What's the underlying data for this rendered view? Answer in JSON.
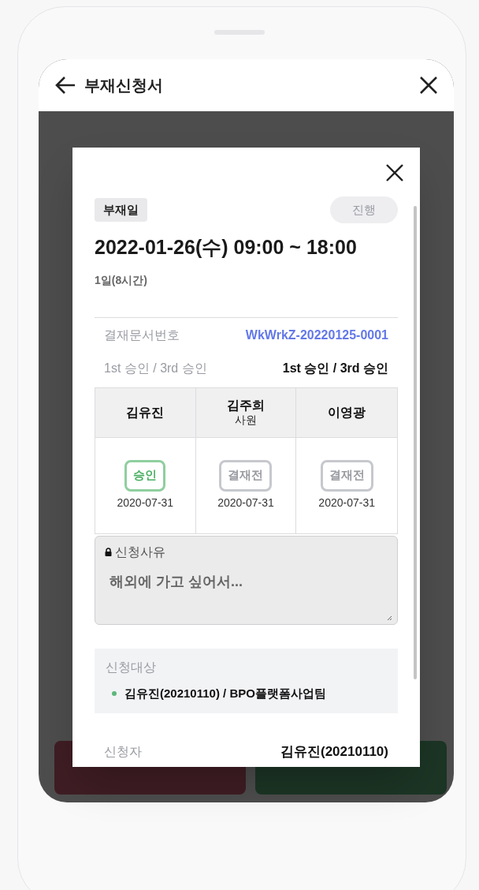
{
  "header": {
    "title": "부재신청서"
  },
  "modal": {
    "type_badge": "부재일",
    "status_badge": "진행",
    "datetime": "2022-01-26(수) 09:00 ~ 18:00",
    "duration": "1일(8시간)",
    "doc_number": {
      "label": "결재문서번호",
      "value": "WkWrkZ-20220125-0001"
    },
    "approval_line": {
      "label": "1st 승인 / 3rd 승인",
      "value": "1st 승인 / 3rd 승인"
    },
    "approvers": [
      {
        "name": "김유진",
        "kind": "approved",
        "status": "승인",
        "date": "2020-07-31"
      },
      {
        "name": "김주희",
        "position": "사원",
        "kind": "pending",
        "status": "결재전",
        "date": "2020-07-31"
      },
      {
        "name": "이영광",
        "kind": "pending",
        "status": "결재전",
        "date": "2020-07-31"
      }
    ],
    "reason": {
      "label": "신청사유",
      "value": "해외에 가고 싶어서...",
      "disabled": true
    },
    "targets": {
      "label": "신청대상",
      "items": [
        {
          "text": "김유진(20210110) / BPO플랫폼사업팀",
          "color": "#5cb87a"
        }
      ]
    },
    "applicant": {
      "label": "신청자",
      "value": "김유진(20210110)"
    }
  }
}
